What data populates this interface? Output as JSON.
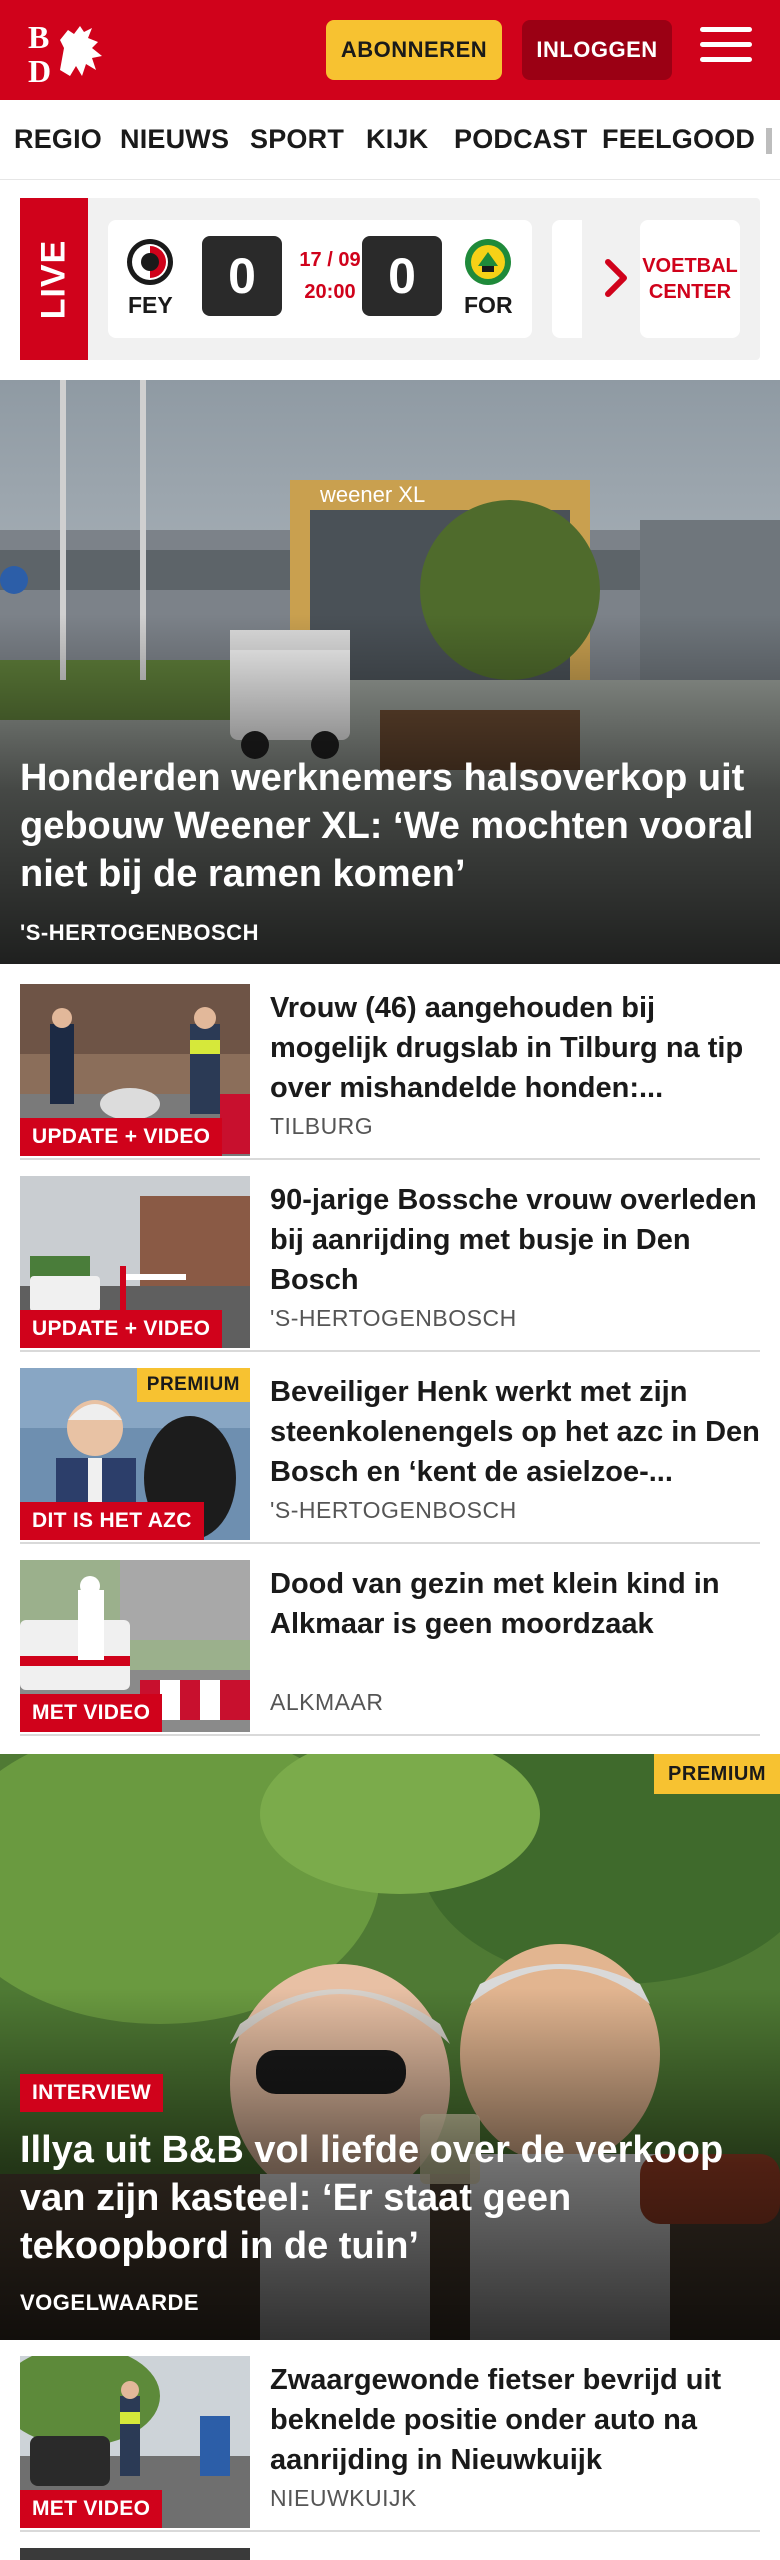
{
  "header": {
    "logo_text": "BD",
    "subscribe_label": "ABONNEREN",
    "login_label": "INLOGGEN",
    "brand_color": "#d0021b",
    "accent_color": "#f7c231"
  },
  "nav": {
    "items": [
      {
        "label": "REGIO"
      },
      {
        "label": "NIEUWS"
      },
      {
        "label": "SPORT"
      },
      {
        "label": "KIJK"
      },
      {
        "label": "PODCAST"
      },
      {
        "label": "FEELGOOD"
      }
    ]
  },
  "live": {
    "label": "LIVE",
    "match": {
      "home": "FEY",
      "away": "FOR",
      "home_score": "0",
      "away_score": "0",
      "date": "17 / 09",
      "time": "20:00"
    },
    "football_label": "VOETBAL CENTER"
  },
  "hero": {
    "title": "Honderden werknemers halsoverkop uit gebouw Weener XL: ‘We mochten vooral niet bij de ramen komen’",
    "location": "'S-HERTOGENBOSCH",
    "sign_text": "weener XL"
  },
  "articles": [
    {
      "tag": "UPDATE + VIDEO",
      "premium": "",
      "title": "Vrouw (46) aangehouden bij mogelijk drugslab in Tilburg na tip over mishandelde honden:...",
      "location": "TILBURG"
    },
    {
      "tag": "UPDATE + VIDEO",
      "premium": "",
      "title": "90-jarige Bossche vrouw overleden bij aanrijding met busje in Den Bosch",
      "location": "'S-HERTOGENBOSCH"
    },
    {
      "tag": "DIT IS HET AZC",
      "premium": "PREMIUM",
      "title": "Beveiliger Henk werkt met zijn steenkolenengels op het azc in Den Bosch en ‘kent de asielzoe-...",
      "location": "'S-HERTOGENBOSCH"
    },
    {
      "tag": "MET VIDEO",
      "premium": "",
      "title": "Dood van gezin met klein kind in Alkmaar is geen moordzaak",
      "location": "ALKMAAR"
    }
  ],
  "feature": {
    "premium": "PREMIUM",
    "tag": "INTERVIEW",
    "title": "Illya uit B&B vol liefde over de verkoop van zijn kasteel: ‘Er staat geen tekoopbord in de tuin’",
    "location": "VOGELWAARDE"
  },
  "articles2": [
    {
      "tag": "MET VIDEO",
      "title": "Zwaargewonde fietser bevrijd uit beknelde positie onder auto na aanrijding in Nieuwkuijk",
      "location": "NIEUWKUIJK"
    }
  ]
}
